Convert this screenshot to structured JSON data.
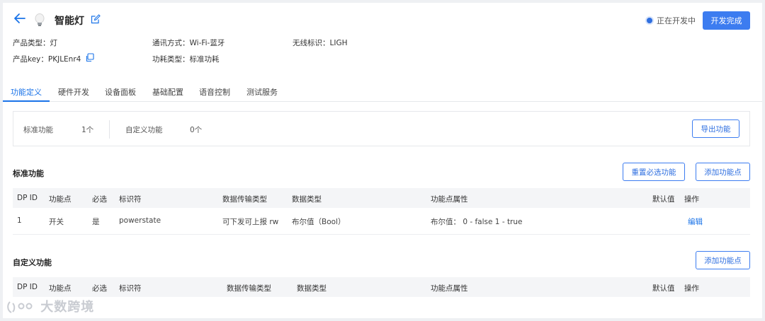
{
  "header": {
    "back_icon": "back-arrow-icon",
    "product_icon": "lightbulb-icon",
    "title": "智能灯",
    "edit_icon": "edit-icon",
    "status": "正在开发中",
    "status_color": "#2f6fe0",
    "complete_button": "开发完成",
    "accent_color": "#3c7cf0"
  },
  "info": {
    "product_type": "产品类型：灯",
    "comm_method": "通讯方式：Wi-Fi-蓝牙",
    "wireless_id": "无线标识：LIGH",
    "product_key": "产品key：PKJLEnr4",
    "power_type": "功耗类型：标准功耗",
    "copy_icon": "copy-icon"
  },
  "tabs": [
    {
      "label": "功能定义",
      "active": true
    },
    {
      "label": "硬件开发"
    },
    {
      "label": "设备面板"
    },
    {
      "label": "基础配置"
    },
    {
      "label": "语音控制"
    },
    {
      "label": "测试服务"
    }
  ],
  "summary": {
    "standard_label": "标准功能",
    "standard_count": "1个",
    "custom_label": "自定义功能",
    "custom_count": "0个",
    "export_button": "导出功能"
  },
  "standard_section": {
    "title": "标准功能",
    "reset_button": "重置必选功能",
    "add_button": "添加功能点",
    "columns": [
      "DP ID",
      "功能点",
      "必选",
      "标识符",
      "数据传输类型",
      "数据类型",
      "功能点属性",
      "默认值",
      "操作"
    ],
    "rows": [
      {
        "dp_id": "1",
        "name": "开关",
        "required": "是",
        "identifier": "powerstate",
        "transfer": "可下发可上报 rw",
        "data_type": "布尔值（Bool）",
        "attributes": "布尔值： 0 - false 1 - true",
        "default": "",
        "action": "编辑"
      }
    ]
  },
  "custom_section": {
    "title": "自定义功能",
    "add_button": "添加功能点",
    "columns": [
      "DP ID",
      "功能点",
      "必选",
      "标识符",
      "数据传输类型",
      "数据类型",
      "功能点属性",
      "默认值",
      "操作"
    ]
  },
  "watermark": "大数跨境"
}
